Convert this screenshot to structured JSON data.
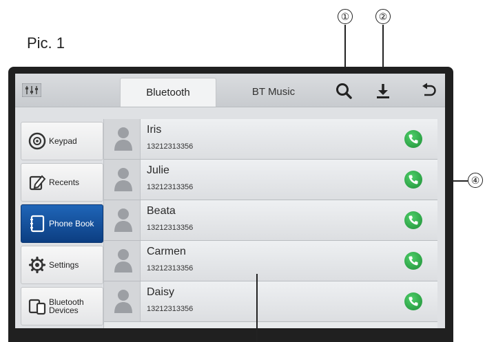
{
  "figure": {
    "label": "Pic. 1",
    "callouts": [
      "①",
      "②",
      "④"
    ]
  },
  "tabs": {
    "active": "Bluetooth",
    "inactive": "BT Music"
  },
  "toolbar": {
    "icons": [
      "equalizer-icon",
      "search-icon",
      "download-icon",
      "back-icon"
    ]
  },
  "sidebar": {
    "items": [
      {
        "label": "Keypad",
        "icon": "keypad-icon"
      },
      {
        "label": "Recents",
        "icon": "recents-icon"
      },
      {
        "label": "Phone Book",
        "icon": "phonebook-icon",
        "active": true
      },
      {
        "label": "Settings",
        "icon": "gear-icon"
      },
      {
        "label": "Bluetooth Devices",
        "icon": "devices-icon"
      }
    ]
  },
  "contacts": [
    {
      "name": "Iris",
      "number": "13212313356"
    },
    {
      "name": "Julie",
      "number": "13212313356"
    },
    {
      "name": "Beata",
      "number": "13212313356"
    },
    {
      "name": "Carmen",
      "number": "13212313356"
    },
    {
      "name": "Daisy",
      "number": "13212313356"
    }
  ],
  "colors": {
    "active_item": "#0c3e82",
    "call_button": "#1e8e36",
    "screen_bg": "#dfe1e4"
  }
}
